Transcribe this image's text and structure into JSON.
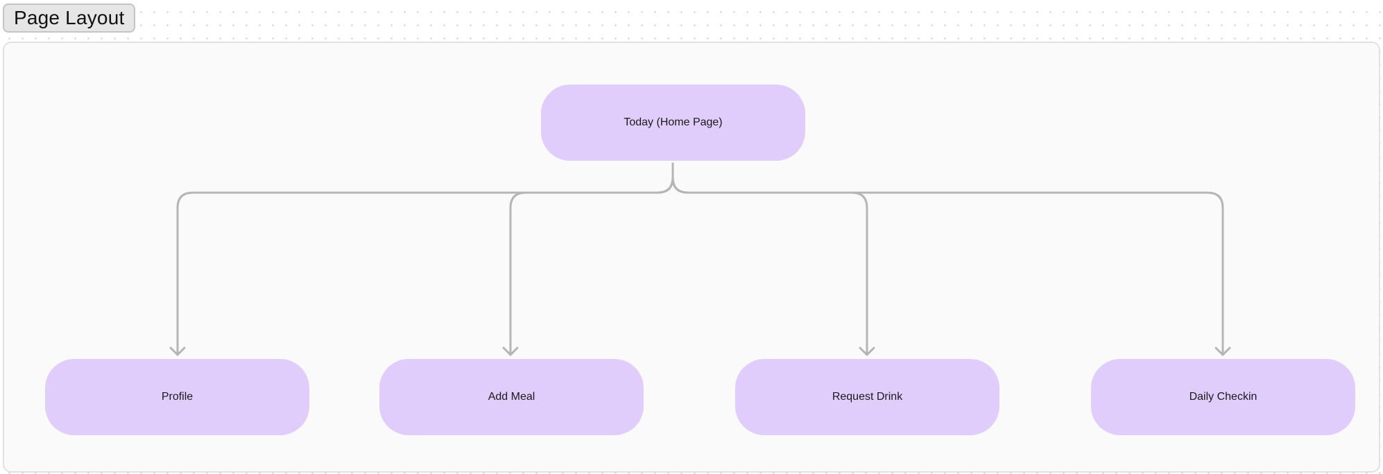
{
  "frame": {
    "title": "Page Layout"
  },
  "nodes": {
    "root": "Today (Home Page)",
    "children": [
      "Profile",
      "Add Meal",
      "Request Drink",
      "Daily Checkin"
    ]
  },
  "colors": {
    "node_fill": "#e0cdfb",
    "connector": "#b5b5b5",
    "frame_fill": "#fafafa"
  },
  "edges": [
    {
      "from": "Today (Home Page)",
      "to": "Profile"
    },
    {
      "from": "Today (Home Page)",
      "to": "Add Meal"
    },
    {
      "from": "Today (Home Page)",
      "to": "Request Drink"
    },
    {
      "from": "Today (Home Page)",
      "to": "Daily Checkin"
    }
  ]
}
